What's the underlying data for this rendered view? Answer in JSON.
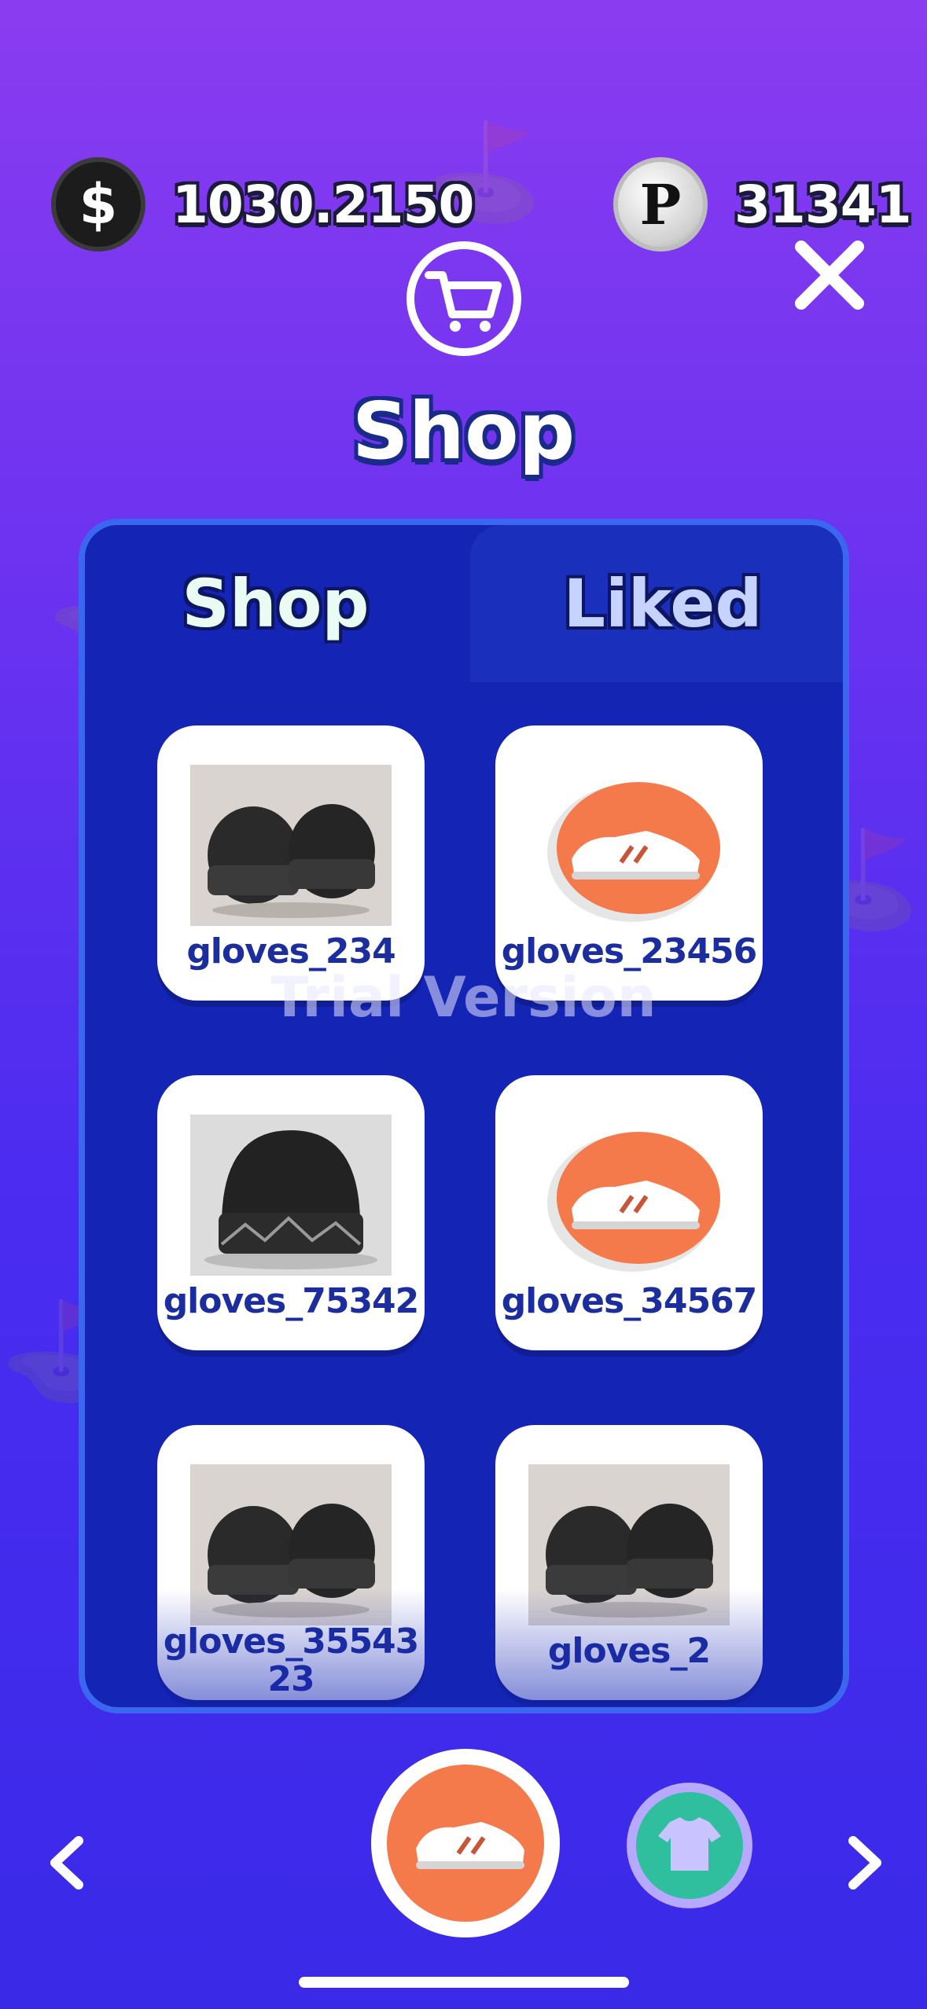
{
  "header": {
    "currency_dollar": {
      "value": "1030.2150",
      "icon": "dollar-coin-icon"
    },
    "currency_points": {
      "value": "31341",
      "icon": "p-coin-icon"
    },
    "close_icon": "close-icon",
    "cart_icon": "shopping-cart-icon",
    "title": "Shop"
  },
  "tabs": [
    {
      "label": "Shop",
      "active": true
    },
    {
      "label": "Liked",
      "active": false
    }
  ],
  "items": [
    {
      "label": "gloves_234",
      "thumb": "beanie-pair"
    },
    {
      "label": "gloves_23456",
      "thumb": "sneaker-icon"
    },
    {
      "label": "gloves_75342",
      "thumb": "beanie-single"
    },
    {
      "label": "gloves_34567",
      "thumb": "sneaker-icon"
    },
    {
      "label": "gloves_3554323",
      "thumb": "beanie-pair"
    },
    {
      "label": "gloves_2",
      "thumb": "beanie-pair"
    }
  ],
  "watermark": "Trial Version",
  "footer": {
    "prev_icon": "chevron-left-icon",
    "next_icon": "chevron-right-icon",
    "category_selected_icon": "sneaker-icon",
    "category_other_icon": "shirt-icon"
  },
  "colors": {
    "accent_orange": "#f47a4c",
    "panel_blue": "#1424b4",
    "label_blue": "#1c2e9e",
    "teal": "#2fbf9f"
  }
}
